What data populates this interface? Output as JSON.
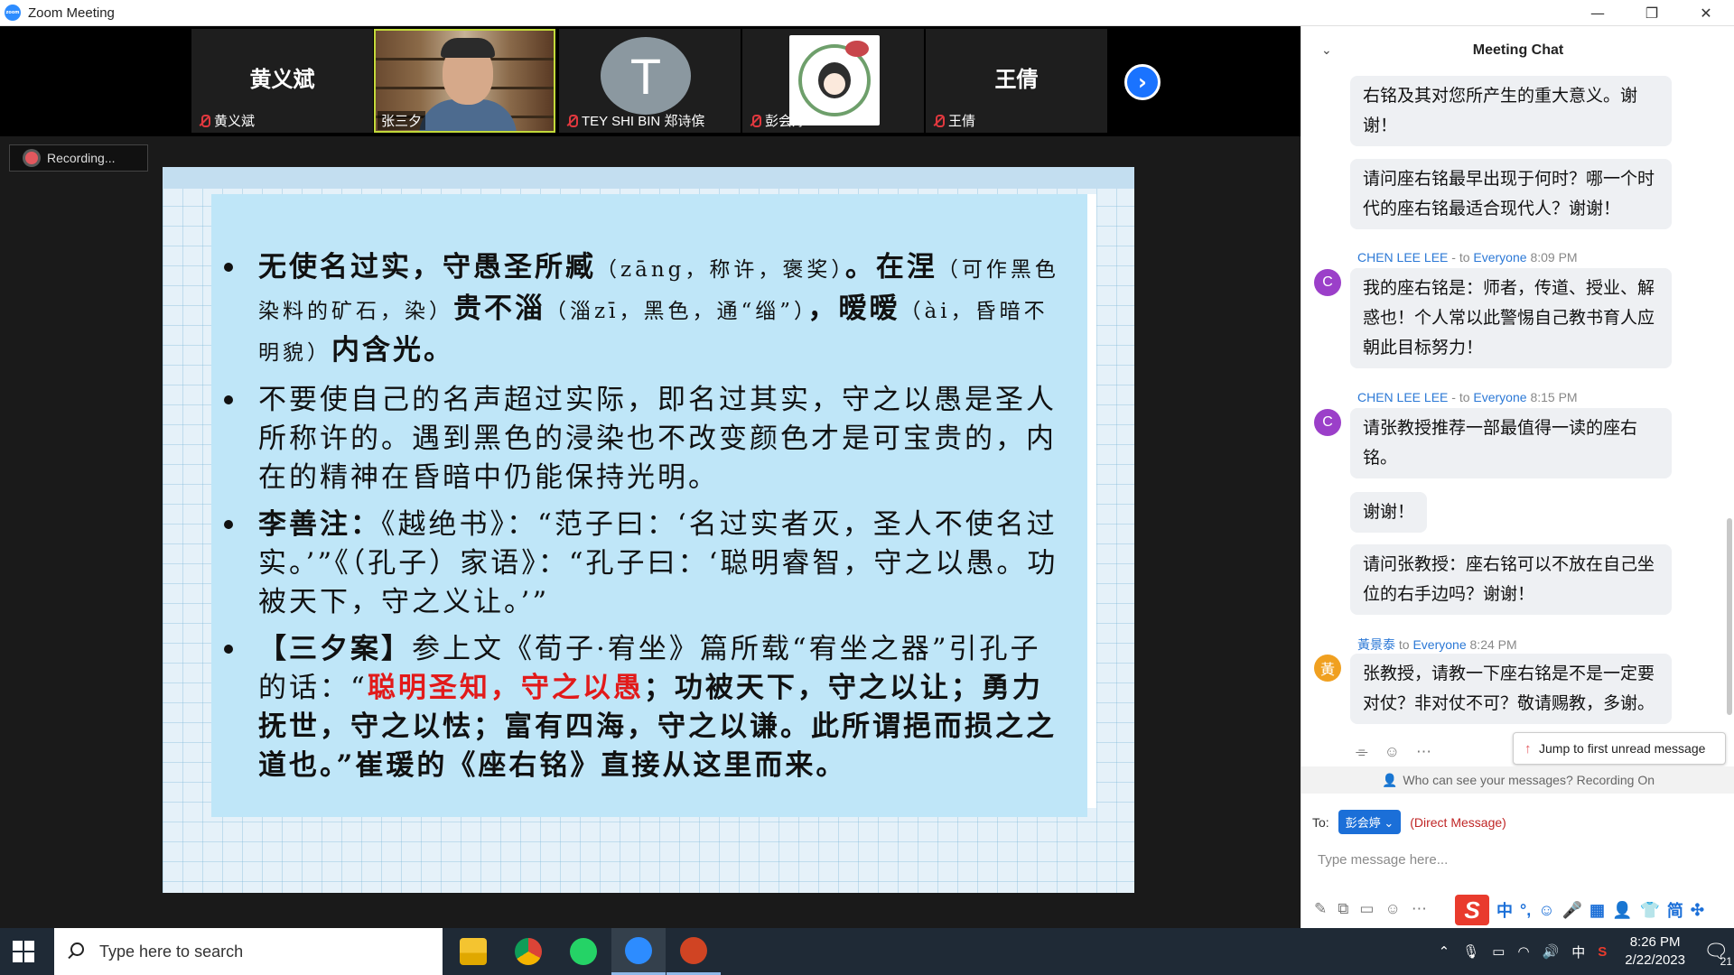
{
  "window": {
    "title": "Zoom Meeting",
    "app_icon_text": "zoom",
    "controls": [
      "—",
      "❐",
      "✕"
    ]
  },
  "participants": [
    {
      "display": "黄义斌",
      "label": "黄义斌",
      "muted": true
    },
    {
      "display": "",
      "label": "张三夕",
      "muted": false
    },
    {
      "display": "T",
      "label": "TEY SHI BIN 郑诗傧",
      "muted": true
    },
    {
      "display": "",
      "label": "彭会婷",
      "muted": true
    },
    {
      "display": "王倩",
      "label": "王倩",
      "muted": true
    }
  ],
  "next_page_icon": "›",
  "recording": {
    "label": "Recording..."
  },
  "slide": {
    "b1_a": "无使名过实，守愚圣所臧",
    "b1_b": "（zāng，称许，褒奖）",
    "b1_c": "。在涅",
    "b1_d": "（可作黑色染料的矿石，染）",
    "b1_e": "贵不淄",
    "b1_f": "（淄zī，黑色，通“缁”）",
    "b1_g": "，暧暧",
    "b1_h": "（ài，昏暗不明貌）",
    "b1_i": "内含光。",
    "b2": "不要使自己的名声超过实际，即名过其实，守之以愚是圣人所称许的。遇到黑色的浸染也不改变颜色才是可宝贵的，内在的精神在昏暗中仍能保持光明。",
    "b3_a": "李善注：",
    "b3_b": "《越绝书》：“范子曰：‘名过实者灭，圣人不使名过实。’”《（孔子）家语》：“孔子曰：‘聪明睿智，守之以愚。功被天下，守之义让。’”",
    "b4_a": "【三夕案】",
    "b4_b": "参上文《荀子·宥坐》篇所载“宥坐之器”引孔子的话：“",
    "b4_red": "聪明圣知，守之以愚",
    "b4_c": "；功被天下，守之以让；勇力抚世，守之以怯；富有四海，守之以谦。此所谓挹而损之之道也。”崔瑗的《座右铭》直接从这里而来。"
  },
  "chat": {
    "title": "Meeting Chat",
    "collapse_icon": "⌄",
    "messages": [
      {
        "text": "右铭及其对您所产生的重大意义。谢谢！"
      },
      {
        "text": "请问座右铭最早出现于何时？哪一个时代的座右铭最适合现代人？谢谢！"
      },
      {
        "sender": "CHEN LEE LEE",
        "to_prefix": "- to",
        "to": "Everyone",
        "time": "8:09 PM",
        "avatar": "C",
        "text": "我的座右铭是：师者，传道、授业、解惑也！个人常以此警惕自己教书育人应朝此目标努力！"
      },
      {
        "sender": "CHEN LEE LEE",
        "to_prefix": "- to",
        "to": "Everyone",
        "time": "8:15 PM",
        "avatar": "C",
        "text": "请张教授推荐一部最值得一读的座右铭。"
      },
      {
        "text": "谢谢！"
      },
      {
        "text": "请问张教授：座右铭可以不放在自己坐位的右手边吗？谢谢！"
      },
      {
        "sender": "黃景泰",
        "to_prefix": "to",
        "to": "Everyone",
        "time": "8:24 PM",
        "avatar": "黃",
        "text": "张教授，请教一下座右铭是不是一定要对仗？非对仗不可？敬请赐教，多谢。"
      }
    ],
    "jump_label": "Jump to first unread message",
    "who_can_see": "Who can see your messages? Recording On",
    "to_label": "To:",
    "recipient": "彭会婷",
    "direct_label": "(Direct Message)",
    "input_placeholder": "Type message here...",
    "ime": {
      "logo": "S",
      "keys": [
        "中",
        "°,",
        "☺",
        "🎤",
        "▦",
        "👤",
        "👕",
        "简",
        "✣"
      ]
    }
  },
  "taskbar": {
    "search_placeholder": "Type here to search",
    "time": "8:26 PM",
    "date": "2/22/2023",
    "ime_indicator": "中",
    "notifications": "21"
  },
  "colors": {
    "zoom_blue": "#2d8cff",
    "chat_link": "#2b78d6",
    "slide_box": "#bfe6f8",
    "highlight_red": "#e21a1a"
  }
}
